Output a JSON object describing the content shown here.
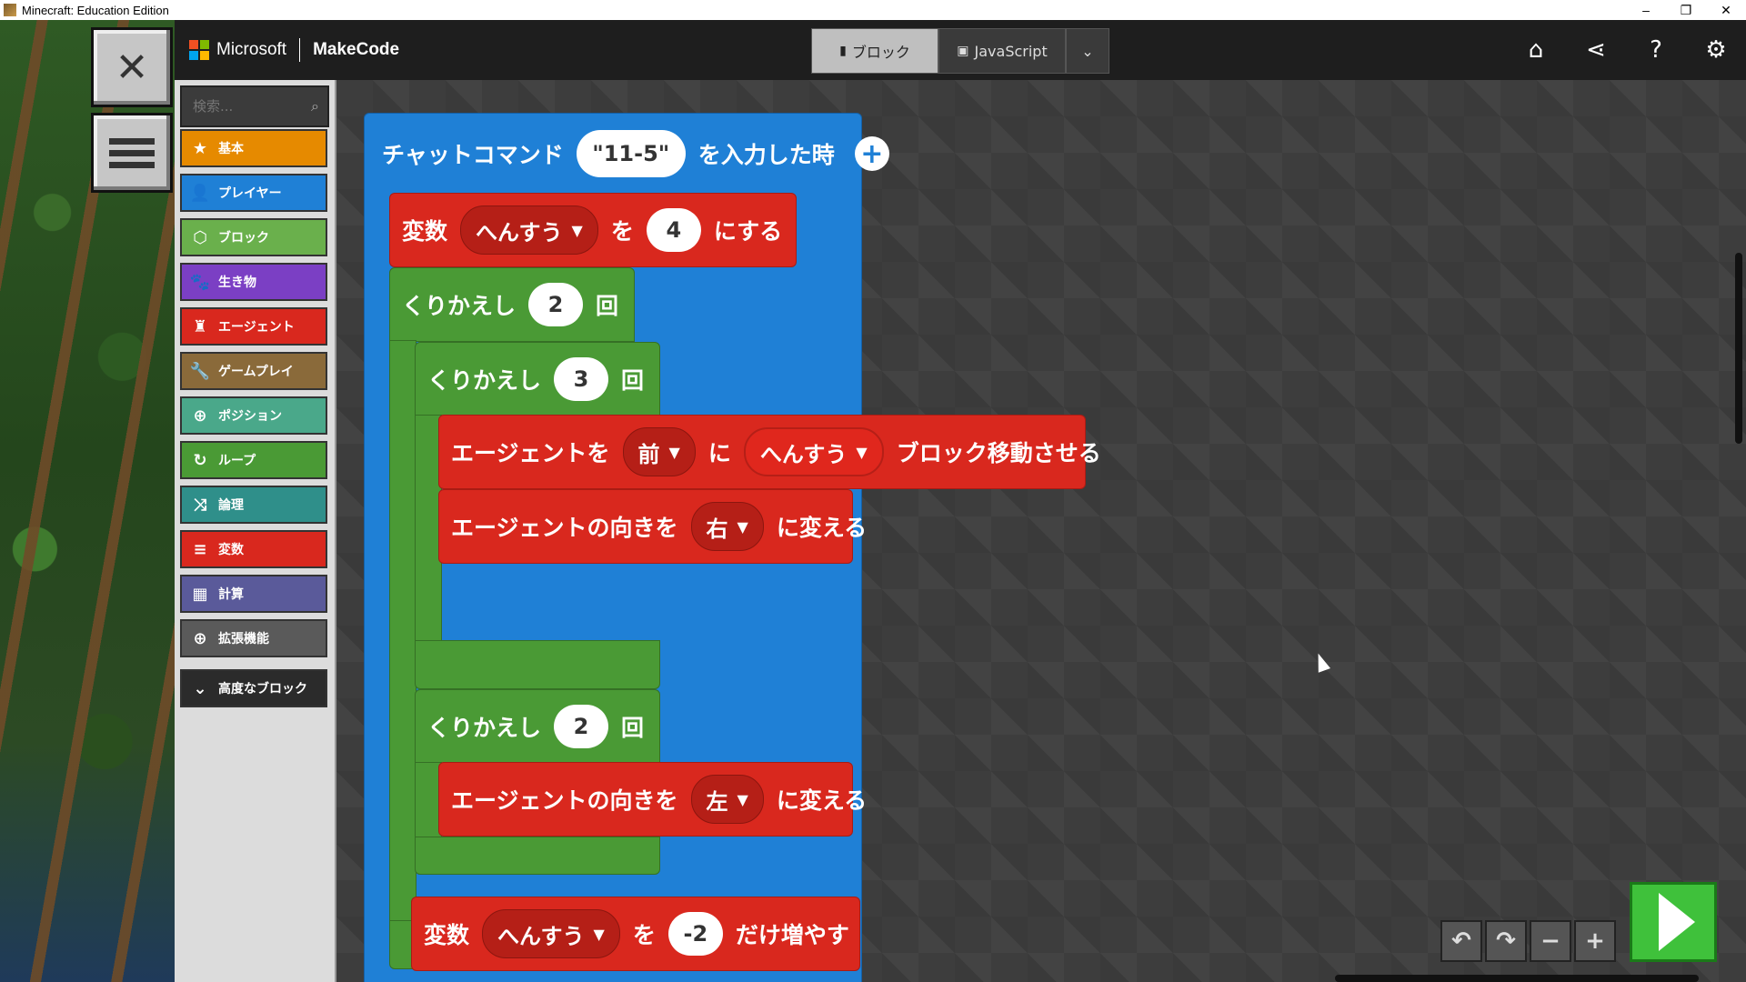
{
  "window": {
    "title": "Minecraft: Education Edition",
    "minimize": "–",
    "restore": "❐",
    "close": "✕"
  },
  "header": {
    "brand": "Microsoft",
    "product": "MakeCode",
    "ms_colors": [
      "#f25022",
      "#7fba00",
      "#00a4ef",
      "#ffb900"
    ],
    "blocks_tab": "ブロック",
    "js_tab": "JavaScript",
    "icons": [
      "home-icon",
      "share-icon",
      "help-icon",
      "settings-icon"
    ]
  },
  "search": {
    "placeholder": "検索..."
  },
  "categories": [
    {
      "label": "基本",
      "color": "#e68a00",
      "icon": "star-icon",
      "glyph": "★"
    },
    {
      "label": "プレイヤー",
      "color": "#1f80d6",
      "icon": "player-icon",
      "glyph": "👤"
    },
    {
      "label": "ブロック",
      "color": "#6ab04c",
      "icon": "cube-icon",
      "glyph": "⬡"
    },
    {
      "label": "生き物",
      "color": "#7b3fc4",
      "icon": "paw-icon",
      "glyph": "🐾"
    },
    {
      "label": "エージェント",
      "color": "#d9281e",
      "icon": "agent-icon",
      "glyph": "♜"
    },
    {
      "label": "ゲームプレイ",
      "color": "#8a6a3a",
      "icon": "wrench-icon",
      "glyph": "🔧"
    },
    {
      "label": "ポジション",
      "color": "#4aa88a",
      "icon": "crosshair-icon",
      "glyph": "⊕"
    },
    {
      "label": "ループ",
      "color": "#4a9a35",
      "icon": "loop-icon",
      "glyph": "↻"
    },
    {
      "label": "論理",
      "color": "#2f8f8a",
      "icon": "shuffle-icon",
      "glyph": "⤨"
    },
    {
      "label": "変数",
      "color": "#d9281e",
      "icon": "list-icon",
      "glyph": "≡"
    },
    {
      "label": "計算",
      "color": "#5a5a9a",
      "icon": "calculator-icon",
      "glyph": "▦"
    },
    {
      "label": "拡張機能",
      "color": "#5a5a5a",
      "icon": "plus-circle-icon",
      "glyph": "⊕"
    }
  ],
  "advanced": {
    "label": "高度なブロック"
  },
  "blocks": {
    "event": {
      "pre": "チャットコマンド",
      "value": "\"11-5\"",
      "post": "を入力した時"
    },
    "set_var": {
      "pre": "変数",
      "var": "へんすう",
      "mid": "を",
      "value": "4",
      "post": "にする"
    },
    "repeat_outer": {
      "pre": "くりかえし",
      "value": "2",
      "post": "回"
    },
    "repeat_inner1": {
      "pre": "くりかえし",
      "value": "3",
      "post": "回"
    },
    "move": {
      "pre": "エージェントを",
      "dir": "前",
      "mid": "に",
      "var": "へんすう",
      "post": "ブロック移動させる"
    },
    "turn_right": {
      "pre": "エージェントの向きを",
      "dir": "右",
      "post": "に変える"
    },
    "repeat_inner2": {
      "pre": "くりかえし",
      "value": "2",
      "post": "回"
    },
    "turn_left": {
      "pre": "エージェントの向きを",
      "dir": "左",
      "post": "に変える"
    },
    "change_var": {
      "pre": "変数",
      "var": "へんすう",
      "mid": "を",
      "value": "-2",
      "post": "だけ増やす"
    }
  },
  "controls": {
    "undo": "↶",
    "redo": "↷",
    "zoom_out": "−",
    "zoom_in": "+"
  }
}
